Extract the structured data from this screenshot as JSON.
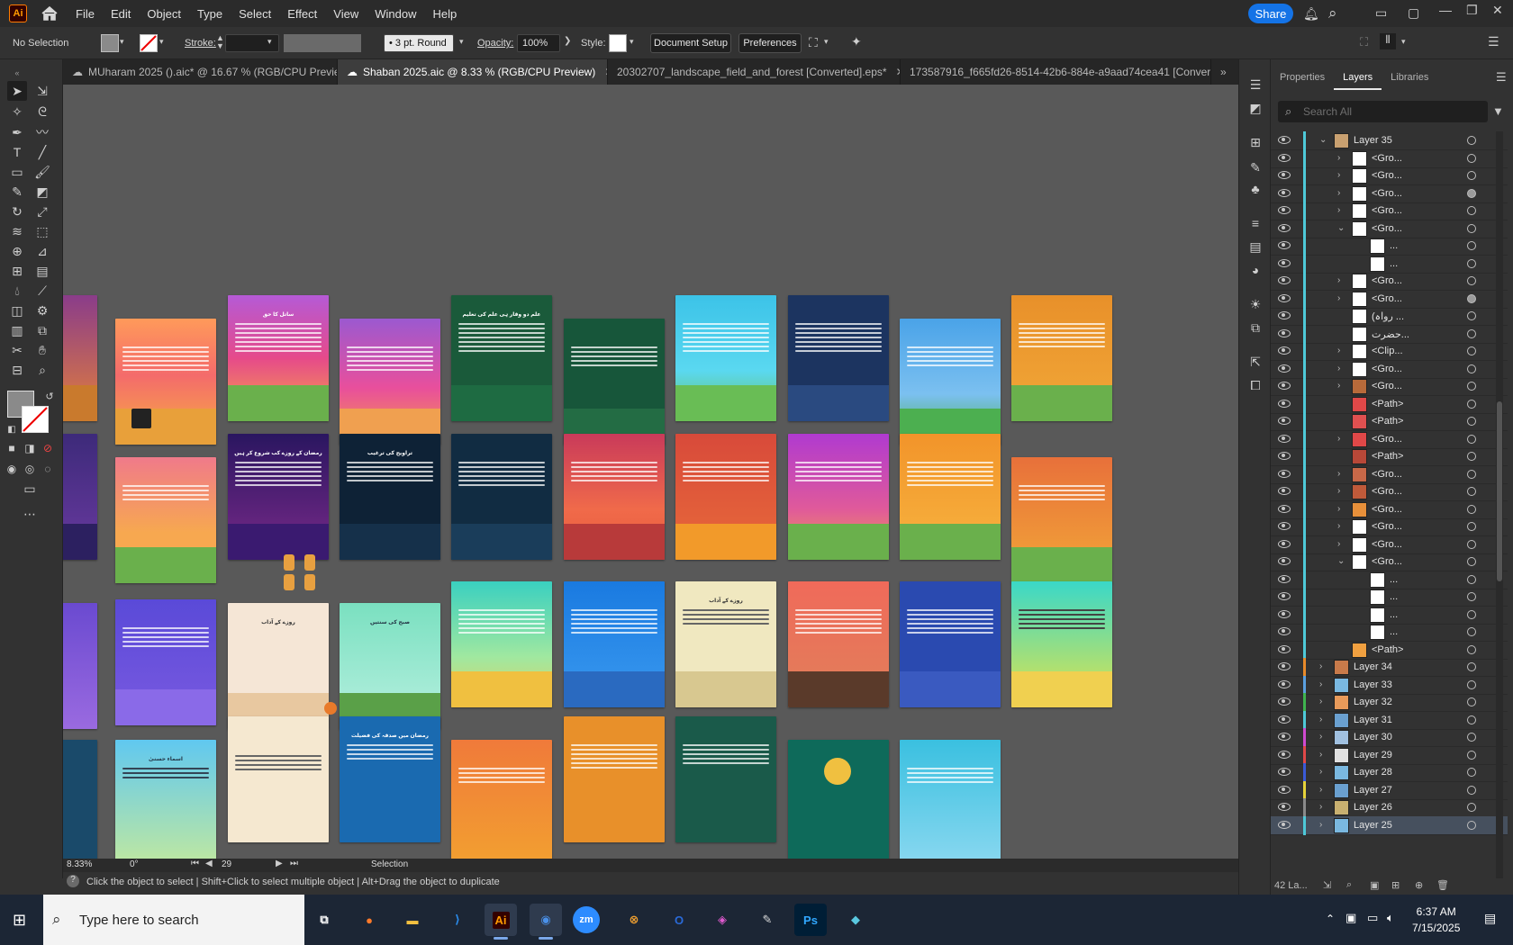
{
  "app": {
    "logo": "Ai",
    "menu": [
      "File",
      "Edit",
      "Object",
      "Type",
      "Select",
      "Effect",
      "View",
      "Window",
      "Help"
    ],
    "share_label": "Share"
  },
  "control_bar": {
    "selection": "No Selection",
    "stroke_label": "Stroke:",
    "brush_label": "3 pt. Round",
    "opacity_label": "Opacity:",
    "opacity_value": "100%",
    "style_label": "Style:",
    "document_setup": "Document Setup",
    "preferences": "Preferences"
  },
  "tabs": [
    {
      "label": "MUharam 2025 ().aic* @ 16.67 % (RGB/CPU Previe...",
      "active": false
    },
    {
      "label": "Shaban 2025.aic @ 8.33 % (RGB/CPU Preview)",
      "active": true
    },
    {
      "label": "20302707_landscape_field_and_forest [Converted].eps*",
      "active": false
    },
    {
      "label": "173587916_f665fd26-8514-42b6-884e-a9aad74cea41 [Converte",
      "active": false
    }
  ],
  "status": {
    "hint": "Click the object to select  |  Shift+Click to select multiple object  |  Alt+Drag the object to duplicate",
    "zoom": "8.33%",
    "rotation": "0°",
    "artboard": "29",
    "tool": "Selection"
  },
  "panel": {
    "tabs": [
      "Properties",
      "Layers",
      "Libraries"
    ],
    "active_tab": "Layers",
    "search_placeholder": "Search All",
    "layers_count": "42 La...",
    "layers": [
      {
        "name": "Layer 35",
        "indent": 0,
        "expanded": true,
        "color": "#4ec9d8"
      },
      {
        "name": "<Gro...",
        "indent": 1,
        "arrow": true
      },
      {
        "name": "<Gro...",
        "indent": 1,
        "arrow": true
      },
      {
        "name": "<Gro...",
        "indent": 1,
        "arrow": true,
        "filled": true
      },
      {
        "name": "<Gro...",
        "indent": 1,
        "arrow": true
      },
      {
        "name": "<Gro...",
        "indent": 1,
        "arrow": true,
        "expanded": true
      },
      {
        "name": "...",
        "indent": 2
      },
      {
        "name": "...",
        "indent": 2
      },
      {
        "name": "<Gro...",
        "indent": 1,
        "arrow": true
      },
      {
        "name": "<Gro...",
        "indent": 1,
        "arrow": true,
        "filled": true
      },
      {
        "name": "(رواہ ...",
        "indent": 1
      },
      {
        "name": "حضرت...",
        "indent": 1
      },
      {
        "name": "<Clip...",
        "indent": 1,
        "arrow": true
      },
      {
        "name": "<Gro...",
        "indent": 1,
        "arrow": true
      },
      {
        "name": "<Gro...",
        "indent": 1,
        "arrow": true
      },
      {
        "name": "<Path>",
        "indent": 1
      },
      {
        "name": "<Path>",
        "indent": 1
      },
      {
        "name": "<Gro...",
        "indent": 1,
        "arrow": true
      },
      {
        "name": "<Path>",
        "indent": 1
      },
      {
        "name": "<Gro...",
        "indent": 1,
        "arrow": true
      },
      {
        "name": "<Gro...",
        "indent": 1,
        "arrow": true
      },
      {
        "name": "<Gro...",
        "indent": 1,
        "arrow": true
      },
      {
        "name": "<Gro...",
        "indent": 1,
        "arrow": true
      },
      {
        "name": "<Gro...",
        "indent": 1,
        "arrow": true
      },
      {
        "name": "<Gro...",
        "indent": 1,
        "arrow": true,
        "expanded": true
      },
      {
        "name": "...",
        "indent": 2
      },
      {
        "name": "...",
        "indent": 2
      },
      {
        "name": "...",
        "indent": 2
      },
      {
        "name": "...",
        "indent": 2
      },
      {
        "name": "<Path>",
        "indent": 1
      },
      {
        "name": "Layer 34",
        "indent": 0,
        "color": "#e88a2a"
      },
      {
        "name": "Layer 33",
        "indent": 0,
        "color": "#5aa0e0"
      },
      {
        "name": "Layer 32",
        "indent": 0,
        "color": "#3fb44f"
      },
      {
        "name": "Layer 31",
        "indent": 0,
        "color": "#4ec9d8"
      },
      {
        "name": "Layer 30",
        "indent": 0,
        "color": "#d04ad0"
      },
      {
        "name": "Layer 29",
        "indent": 0,
        "color": "#e04848"
      },
      {
        "name": "Layer 28",
        "indent": 0,
        "color": "#3a5ad8"
      },
      {
        "name": "Layer 27",
        "indent": 0,
        "color": "#e6d23a"
      },
      {
        "name": "Layer 26",
        "indent": 0,
        "color": "#8a8a8a"
      },
      {
        "name": "Layer 25",
        "indent": 0,
        "color": "#4ec9d8",
        "selected": true
      }
    ]
  },
  "taskbar": {
    "search_placeholder": "Type here to search",
    "time": "6:37 AM",
    "date": "7/15/2025",
    "apps": [
      "Task View",
      "Firefox",
      "File Explorer",
      "VS Code",
      "Illustrator",
      "Chrome",
      "Zoom",
      "Postman",
      "Outlook",
      "Figma",
      "Pen Tool",
      "Photoshop",
      "App"
    ]
  },
  "colors": {
    "accent": "#1473e6",
    "ai_orange": "#ff9a00",
    "canvas_bg": "#595959",
    "panel_bg": "#323232"
  }
}
